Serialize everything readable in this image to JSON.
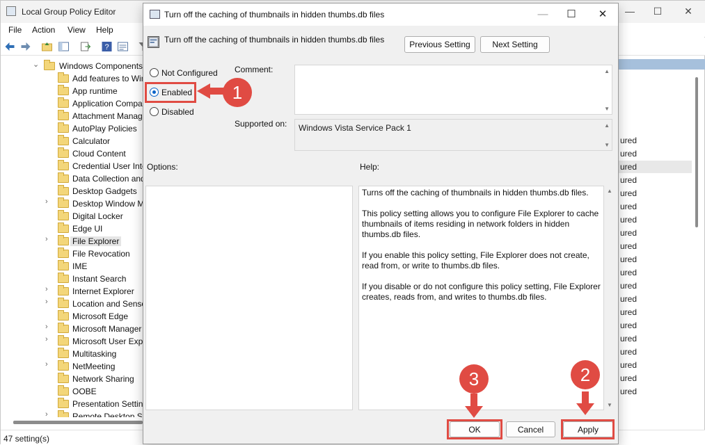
{
  "background_window": {
    "title": "Local Group Policy Editor",
    "caption_buttons": {
      "minimize": "—",
      "maximize": "☐",
      "close": "✕"
    },
    "menu": [
      "File",
      "Action",
      "View",
      "Help"
    ],
    "tree": {
      "root": "Windows Components",
      "items": [
        {
          "label": "Add features to Win",
          "expandable": false
        },
        {
          "label": "App runtime",
          "expandable": false
        },
        {
          "label": "Application Compa",
          "expandable": false
        },
        {
          "label": "Attachment Manag",
          "expandable": false
        },
        {
          "label": "AutoPlay Policies",
          "expandable": false
        },
        {
          "label": "Calculator",
          "expandable": false
        },
        {
          "label": "Cloud Content",
          "expandable": false
        },
        {
          "label": "Credential User Inte",
          "expandable": false
        },
        {
          "label": "Data Collection and",
          "expandable": false
        },
        {
          "label": "Desktop Gadgets",
          "expandable": false
        },
        {
          "label": "Desktop Window M",
          "expandable": true
        },
        {
          "label": "Digital Locker",
          "expandable": false
        },
        {
          "label": "Edge UI",
          "expandable": false
        },
        {
          "label": "File Explorer",
          "expandable": true,
          "selected": true
        },
        {
          "label": "File Revocation",
          "expandable": false
        },
        {
          "label": "IME",
          "expandable": false
        },
        {
          "label": "Instant Search",
          "expandable": false
        },
        {
          "label": "Internet Explorer",
          "expandable": true
        },
        {
          "label": "Location and Senso",
          "expandable": true
        },
        {
          "label": "Microsoft Edge",
          "expandable": false
        },
        {
          "label": "Microsoft Manager",
          "expandable": true
        },
        {
          "label": "Microsoft User Expe",
          "expandable": true
        },
        {
          "label": "Multitasking",
          "expandable": false
        },
        {
          "label": "NetMeeting",
          "expandable": true
        },
        {
          "label": "Network Sharing",
          "expandable": false
        },
        {
          "label": "OOBE",
          "expandable": false
        },
        {
          "label": "Presentation Setting",
          "expandable": false
        },
        {
          "label": "Remote Desktop S",
          "expandable": true
        }
      ]
    },
    "state_column": [
      "ured",
      "ured",
      "ured",
      "ured",
      "ured",
      "ured",
      "ured",
      "ured",
      "ured",
      "ured",
      "ured",
      "ured",
      "ured",
      "ured",
      "ured",
      "ured",
      "ured",
      "ured",
      "ured",
      "ured"
    ],
    "status": "47 setting(s)"
  },
  "dialog": {
    "title": "Turn off the caching of thumbnails in hidden thumbs.db files",
    "setting_name": "Turn off the caching of thumbnails in hidden thumbs.db files",
    "caption_buttons": {
      "minimize": "—",
      "maximize": "☐",
      "close": "✕"
    },
    "previous_setting": "Previous Setting",
    "next_setting": "Next Setting",
    "radios": {
      "not_configured": "Not Configured",
      "enabled": "Enabled",
      "disabled": "Disabled",
      "selected": "enabled"
    },
    "comment_label": "Comment:",
    "comment_value": "",
    "supported_label": "Supported on:",
    "supported_value": "Windows Vista Service Pack 1",
    "options_label": "Options:",
    "help_label": "Help:",
    "help_paragraphs": [
      "Turns off the caching of thumbnails in hidden thumbs.db files.",
      "This policy setting allows you to configure File Explorer to cache thumbnails of items residing in network folders in hidden thumbs.db files.",
      "If you enable this policy setting, File Explorer does not create, read from, or write to thumbs.db files.",
      "If you disable or do not configure this policy setting, File Explorer creates, reads from, and writes to thumbs.db files."
    ],
    "ok": "OK",
    "cancel": "Cancel",
    "apply": "Apply"
  },
  "annotations": {
    "step1": "1",
    "step2": "2",
    "step3": "3",
    "color": "#e04b43"
  }
}
